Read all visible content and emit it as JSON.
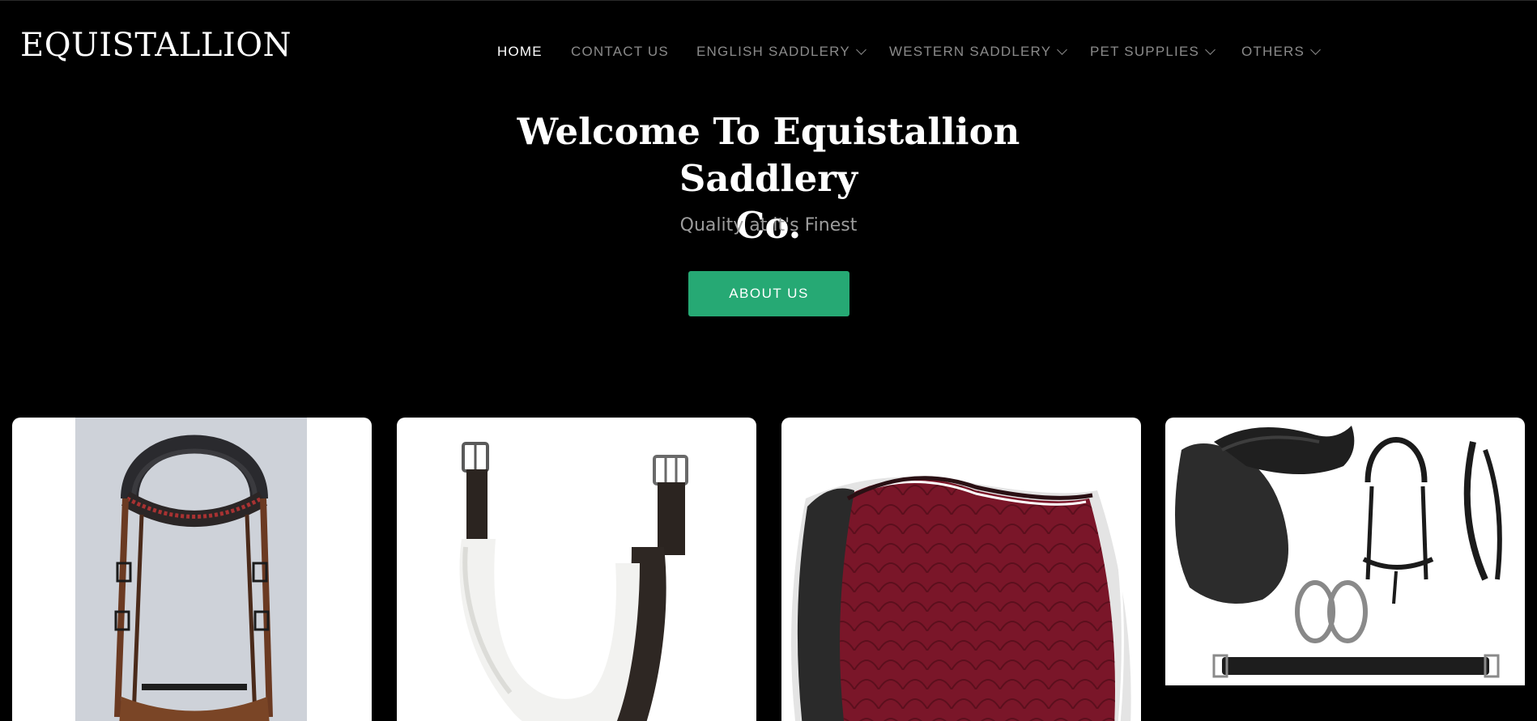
{
  "header": {
    "logo": "EQUISTALLION",
    "nav": [
      {
        "label": "HOME",
        "dropdown": false,
        "active": true
      },
      {
        "label": "CONTACT US",
        "dropdown": false,
        "active": false
      },
      {
        "label": "ENGLISH SADDLERY",
        "dropdown": true,
        "active": false
      },
      {
        "label": "WESTERN SADDLERY",
        "dropdown": true,
        "active": false
      },
      {
        "label": "PET SUPPLIES",
        "dropdown": true,
        "active": false
      },
      {
        "label": "OTHERS",
        "dropdown": true,
        "active": false
      }
    ]
  },
  "hero": {
    "title_line1": "Welcome To Equistallion Saddlery",
    "title_line2": "Co.",
    "subtitle": "Quality at it's Finest",
    "cta_label": "ABOUT US"
  },
  "products": [
    {
      "icon": "bridle-image"
    },
    {
      "icon": "girth-image"
    },
    {
      "icon": "saddle-pad-image"
    },
    {
      "icon": "saddle-set-image"
    }
  ],
  "colors": {
    "background": "#000000",
    "accent": "#26a974",
    "nav_inactive": "#8a8a8a",
    "nav_active": "#ffffff"
  }
}
